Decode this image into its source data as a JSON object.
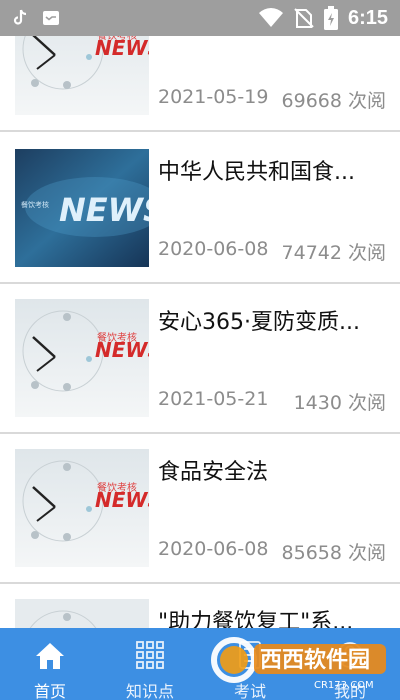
{
  "status_bar": {
    "time": "6:15",
    "left_icons": [
      "tiktok-icon",
      "message-icon"
    ],
    "right_icons": [
      "wifi-icon",
      "no-sim-icon",
      "battery-icon"
    ]
  },
  "thumb_labels": {
    "clock_caption": "餐饮考核",
    "news_word": "NEWS"
  },
  "news": [
    {
      "title": "",
      "date": "2021-05-19",
      "views": "69668 次阅",
      "thumb": "clock"
    },
    {
      "title": "中华人民共和国食...",
      "date": "2020-06-08",
      "views": "74742 次阅",
      "thumb": "blue"
    },
    {
      "title": "安心365·夏防变质...",
      "date": "2021-05-21",
      "views": "1430 次阅",
      "thumb": "clock"
    },
    {
      "title": "食品安全法",
      "date": "2020-06-08",
      "views": "85658 次阅",
      "thumb": "clock"
    },
    {
      "title": "\"助力餐饮复工\"系...",
      "date": "",
      "views": "",
      "thumb": "clock"
    }
  ],
  "bottom_nav": {
    "tabs": [
      {
        "label": "首页",
        "icon": "home-icon",
        "active": true
      },
      {
        "label": "知识点",
        "icon": "grid-icon",
        "active": false
      },
      {
        "label": "考试",
        "icon": "exam-icon",
        "active": false
      },
      {
        "label": "我的",
        "icon": "profile-icon",
        "active": false
      }
    ]
  },
  "watermark": {
    "text": "西西软件园",
    "url_text": "CR173.COM"
  },
  "colors": {
    "nav_bg": "#3d8fe3",
    "status_bg": "#9e9e9e",
    "meta_text": "#8c8c8c"
  }
}
